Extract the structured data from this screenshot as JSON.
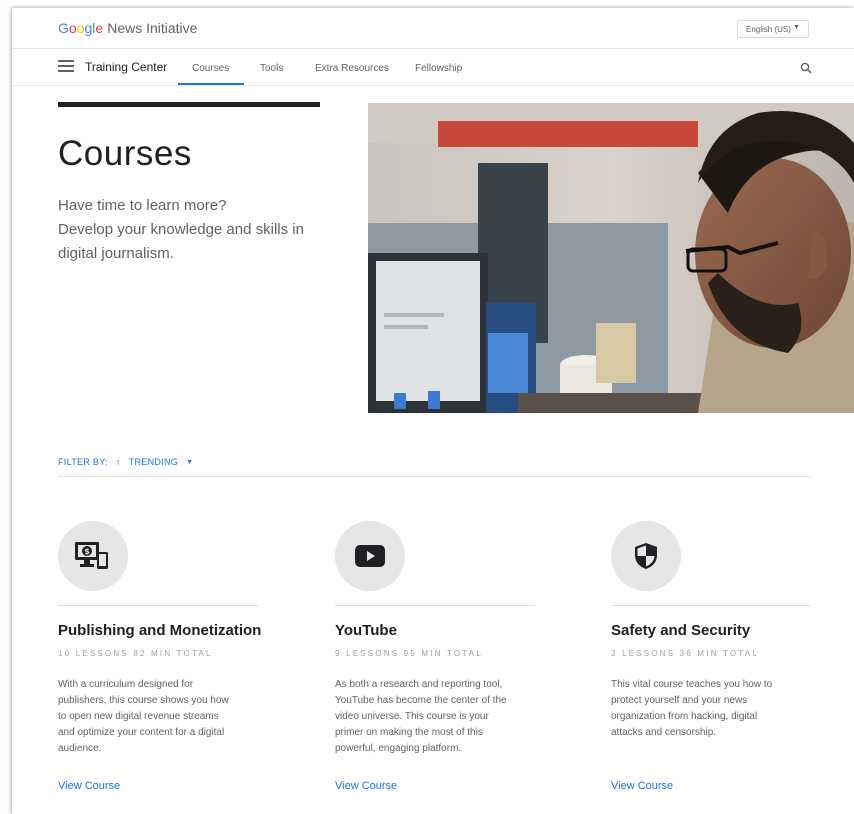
{
  "header": {
    "logo_letters": [
      "G",
      "o",
      "o",
      "g",
      "l",
      "e"
    ],
    "logo_rest": "News Initiative",
    "language": "English (US)"
  },
  "nav": {
    "title": "Training Center",
    "links": [
      "Courses",
      "Tools",
      "Extra Resources",
      "Fellowship"
    ],
    "active": "Courses"
  },
  "hero": {
    "title": "Courses",
    "lines": [
      "Have time to learn more?",
      "Develop your knowledge and skills in",
      "digital journalism."
    ]
  },
  "filter": {
    "label": "FILTER BY:",
    "value": "TRENDING"
  },
  "cards": [
    {
      "icon": "monetization-icon",
      "title": "Publishing and Monetization",
      "meta": "10 LESSONS 82 MIN TOTAL",
      "desc": [
        "With a curriculum designed for",
        "publishers, this course shows you how",
        "to open new digital revenue streams",
        "and optimize your content for a digital",
        "audience."
      ],
      "link": "View Course"
    },
    {
      "icon": "youtube-icon",
      "title": "YouTube",
      "meta": "9 LESSONS 95 MIN TOTAL",
      "desc": [
        "As both a research and reporting tool,",
        "YouTube has become the center of the",
        "video universe. This course is your",
        "primer on making the most of this",
        "powerful, engaging platform."
      ],
      "link": "View Course"
    },
    {
      "icon": "shield-icon",
      "title": "Safety and Security",
      "meta": "3 LESSONS 36 MIN TOTAL",
      "desc": [
        "This vital course teaches you how to",
        "protect yourself and your news",
        "organization from hacking, digital",
        "attacks and censorship."
      ],
      "link": "View Course"
    }
  ],
  "colors": {
    "accent": "#1a73e8",
    "text_dark": "#202124",
    "text_muted": "#5f6368"
  }
}
